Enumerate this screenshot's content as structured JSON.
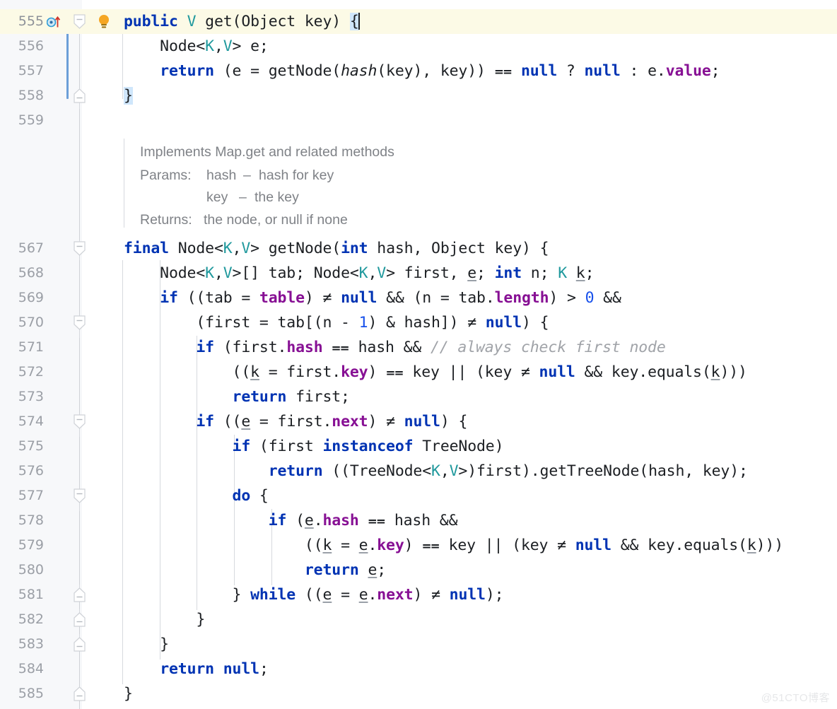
{
  "app": {
    "kind": "code-editor",
    "language": "Java",
    "theme": "IntelliJ Light",
    "watermark": "@51CTO博客"
  },
  "colors": {
    "background": "#ffffff",
    "gutter_background": "#f7f8fa",
    "caret_row_highlight": "#fcfae6",
    "selection": "#cfe6fb",
    "keyword": "#0033b3",
    "type_param": "#20999d",
    "field": "#871094",
    "number": "#1750eb",
    "comment": "#a0a3a8",
    "line_number": "#9b9fa6",
    "indent_guide": "#d6d9de",
    "change_marker": "#6c9fd8",
    "lightbulb": "#f5a623",
    "override_icon": "#2e9bd6",
    "override_arrow": "#d0342c",
    "text": "#1c1f23",
    "javadoc_text": "#7f8287"
  },
  "gutter": {
    "icons": [
      {
        "line": 555,
        "name": "implementing-method-icon",
        "tooltip": "Implements method in Map"
      },
      {
        "line": 555,
        "name": "intention-bulb-icon",
        "tooltip": "Show intention actions"
      }
    ],
    "fold_lines": [
      555,
      558,
      567,
      570,
      574,
      577,
      581,
      582,
      583,
      585
    ]
  },
  "javadoc": {
    "summary": "Implements Map.get and related methods",
    "params_label": "Params:",
    "params": [
      {
        "name": "hash",
        "dash": "–",
        "desc": "hash for key"
      },
      {
        "name": "key",
        "dash": "–",
        "desc": "the key"
      }
    ],
    "returns_label": "Returns:",
    "returns": "the node, or null if none"
  },
  "editor": {
    "first_visible_line": 555,
    "last_visible_line": 585,
    "caret_line": 555,
    "caret_column": 27,
    "lines": [
      {
        "n": 555,
        "text": "    public V get(Object key) {"
      },
      {
        "n": 556,
        "text": "        Node<K,V> e;"
      },
      {
        "n": 557,
        "text": "        return (e = getNode(hash(key), key)) == null ? null : e.value;"
      },
      {
        "n": 558,
        "text": "    }"
      },
      {
        "n": 559,
        "text": ""
      },
      {
        "n": 567,
        "text": "    final Node<K,V> getNode(int hash, Object key) {"
      },
      {
        "n": 568,
        "text": "        Node<K,V>[] tab; Node<K,V> first, e; int n; K k;"
      },
      {
        "n": 569,
        "text": "        if ((tab = table) != null && (n = tab.length) > 0 &&"
      },
      {
        "n": 570,
        "text": "            (first = tab[(n - 1) & hash]) != null) {"
      },
      {
        "n": 571,
        "text": "            if (first.hash == hash && // always check first node"
      },
      {
        "n": 572,
        "text": "                ((k = first.key) == key || (key != null && key.equals(k))))"
      },
      {
        "n": 573,
        "text": "                return first;"
      },
      {
        "n": 574,
        "text": "            if ((e = first.next) != null) {"
      },
      {
        "n": 575,
        "text": "                if (first instanceof TreeNode)"
      },
      {
        "n": 576,
        "text": "                    return ((TreeNode<K,V>)first).getTreeNode(hash, key);"
      },
      {
        "n": 577,
        "text": "                do {"
      },
      {
        "n": 578,
        "text": "                    if (e.hash == hash &&"
      },
      {
        "n": 579,
        "text": "                        ((k = e.key) == key || (key != null && key.equals(k))))"
      },
      {
        "n": 580,
        "text": "                        return e;"
      },
      {
        "n": 581,
        "text": "                } while ((e = e.next) != null);"
      },
      {
        "n": 582,
        "text": "            }"
      },
      {
        "n": 583,
        "text": "        }"
      },
      {
        "n": 584,
        "text": "        return null;"
      },
      {
        "n": 585,
        "text": "    }"
      }
    ],
    "line_numbers": [
      555,
      556,
      557,
      558,
      559,
      567,
      568,
      569,
      570,
      571,
      572,
      573,
      574,
      575,
      576,
      577,
      578,
      579,
      580,
      581,
      582,
      583,
      584,
      585
    ],
    "inline_comment": "// always check first node"
  }
}
